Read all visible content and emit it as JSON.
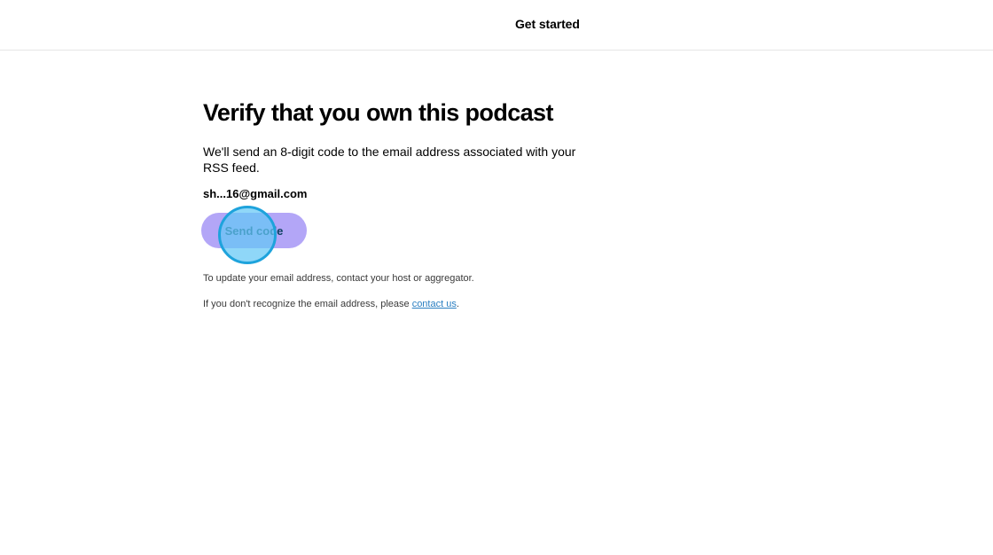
{
  "header": {
    "title": "Get started"
  },
  "main": {
    "title": "Verify that you own this podcast",
    "description": "We'll send an 8-digit code to the email address associated with your RSS feed.",
    "email": "sh...16@gmail.com",
    "send_button_label": "Send code",
    "update_note": "To update your email address, contact your host or aggregator.",
    "recognize_note_prefix": "If you don't recognize the email address, please ",
    "contact_link_label": "contact us",
    "recognize_note_suffix": "."
  },
  "colors": {
    "button_bg": "#b3a6f7",
    "link": "#2a7fc1",
    "click_marker": "#1ea3dc"
  }
}
